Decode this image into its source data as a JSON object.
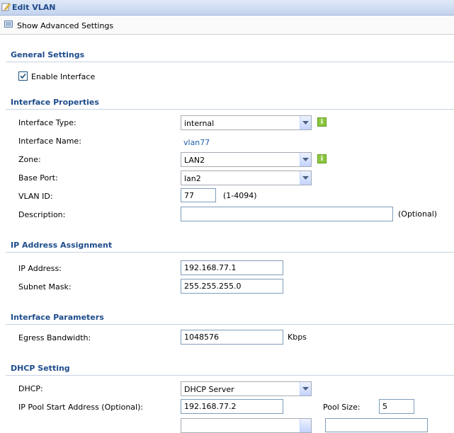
{
  "window": {
    "title": "Edit VLAN"
  },
  "toolbar": {
    "advanced_label": "Show Advanced Settings"
  },
  "general": {
    "heading": "General Settings",
    "enable_label": "Enable Interface",
    "enable_checked": true
  },
  "interface_properties": {
    "heading": "Interface Properties",
    "type_label": "Interface Type:",
    "type_value": "internal",
    "name_label": "Interface Name:",
    "name_value": "vlan77",
    "zone_label": "Zone:",
    "zone_value": "LAN2",
    "base_port_label": "Base Port:",
    "base_port_value": "lan2",
    "vlan_id_label": "VLAN ID:",
    "vlan_id_value": "77",
    "vlan_id_range": "(1-4094)",
    "description_label": "Description:",
    "description_value": "",
    "description_hint": "(Optional)"
  },
  "ip_assignment": {
    "heading": "IP Address Assignment",
    "ip_label": "IP Address:",
    "ip_value": "192.168.77.1",
    "mask_label": "Subnet Mask:",
    "mask_value": "255.255.255.0"
  },
  "interface_parameters": {
    "heading": "Interface Parameters",
    "egress_label": "Egress Bandwidth:",
    "egress_value": "1048576",
    "egress_unit": "Kbps"
  },
  "dhcp": {
    "heading": "DHCP Setting",
    "dhcp_label": "DHCP:",
    "dhcp_value": "DHCP Server",
    "pool_start_label": "IP Pool Start Address (Optional):",
    "pool_start_value": "192.168.77.2",
    "pool_size_label": "Pool Size:",
    "pool_size_value": "5"
  },
  "icons": {
    "title": "edit-icon",
    "toolbar": "advanced-settings-icon",
    "info": "info-icon"
  },
  "colors": {
    "section_heading": "#1e4c8c",
    "title_text": "#1f4a8a",
    "info_green": "#8cc63f",
    "link": "#1f5fa8"
  }
}
